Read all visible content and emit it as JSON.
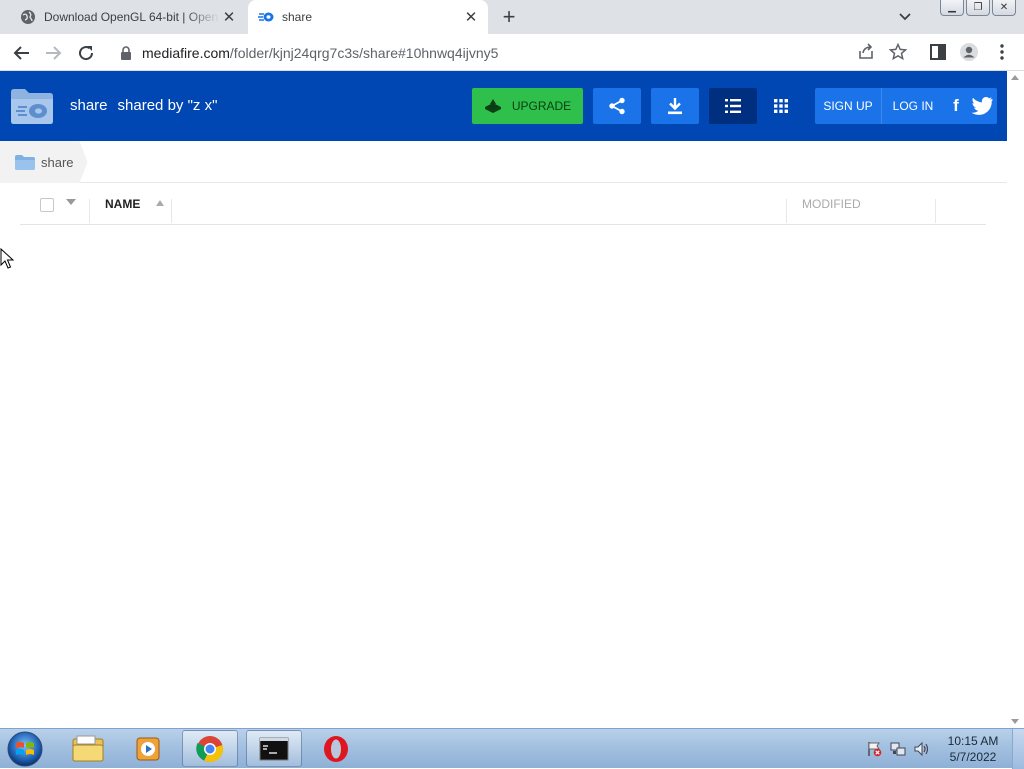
{
  "browser": {
    "tabs": [
      {
        "title": "Download OpenGL 64-bit | Open",
        "active": false,
        "icon": "globe-icon"
      },
      {
        "title": "share",
        "active": true,
        "icon": "mediafire-icon"
      }
    ],
    "address": {
      "domain": "mediafire.com",
      "path": "/folder/kjnj24qrg7c3s/share#10hnwq4ijvny5"
    }
  },
  "header": {
    "folder_name": "share",
    "shared_by": "shared by \"z x\"",
    "upgrade_label": "UPGRADE",
    "sign_up_label": "SIGN UP",
    "log_in_label": "LOG IN",
    "facebook_glyph": "f"
  },
  "breadcrumb": {
    "item": "share"
  },
  "table": {
    "columns": {
      "name": "NAME",
      "modified": "MODIFIED"
    },
    "rows": []
  },
  "taskbar": {
    "time": "10:15 AM",
    "date": "5/7/2022"
  },
  "colors": {
    "mf_blue": "#0047b3",
    "button_blue": "#1a73e8",
    "upgrade_green": "#2ec04a"
  }
}
